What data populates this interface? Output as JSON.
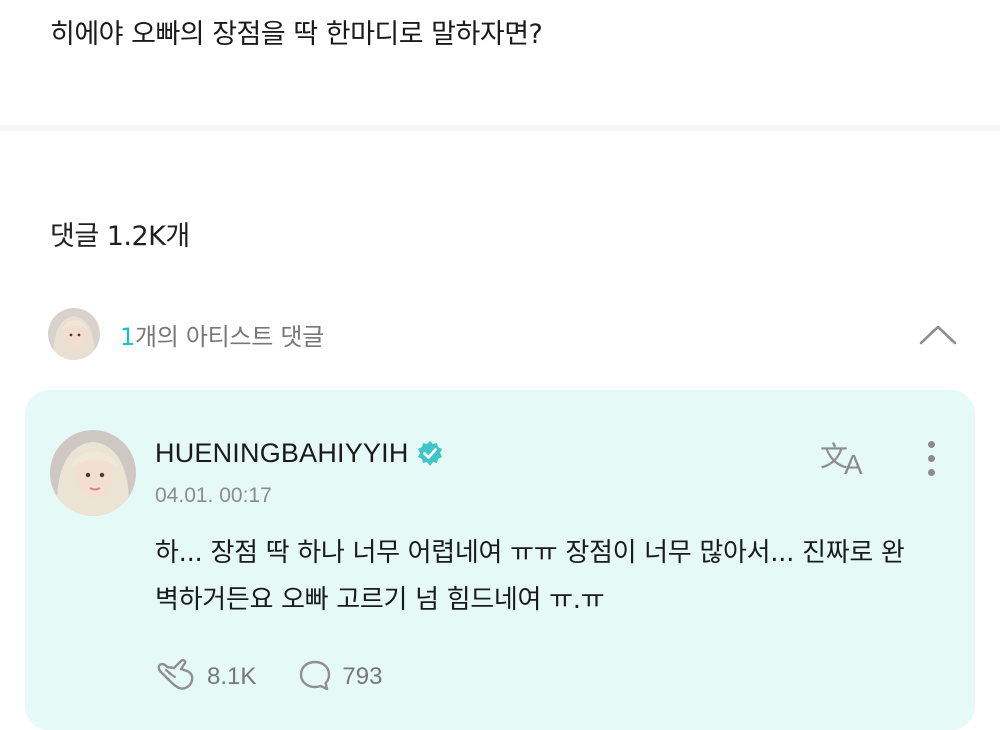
{
  "post": {
    "question": "히에야 오빠의 장점을 딱 한마디로 말하자면?"
  },
  "comments": {
    "label": "댓글",
    "count": "1.2K개"
  },
  "artist_comments": {
    "count": "1",
    "label": "개의 아티스트 댓글"
  },
  "comment": {
    "author": "HUENINGBAHIYYIH",
    "timestamp": "04.01. 00:17",
    "body": "하... 장점 딱 하나 너무 어렵네여 ㅠㅠ  장점이 너무 많아서... 진짜로 완벽하거든요 오빠 고르기 넘 힘드네여 ㅠ.ㅠ",
    "likes": "8.1K",
    "replies": "793"
  },
  "icons": {
    "verified": "verified-badge-icon",
    "translate": "translate-icon",
    "more": "more-vertical-icon",
    "collapse": "chevron-up-icon",
    "like": "like-icon",
    "reply": "reply-icon"
  },
  "colors": {
    "card_bg": "#e5f9f7",
    "accent": "#16c2c8",
    "verified": "#3fc6c6"
  }
}
